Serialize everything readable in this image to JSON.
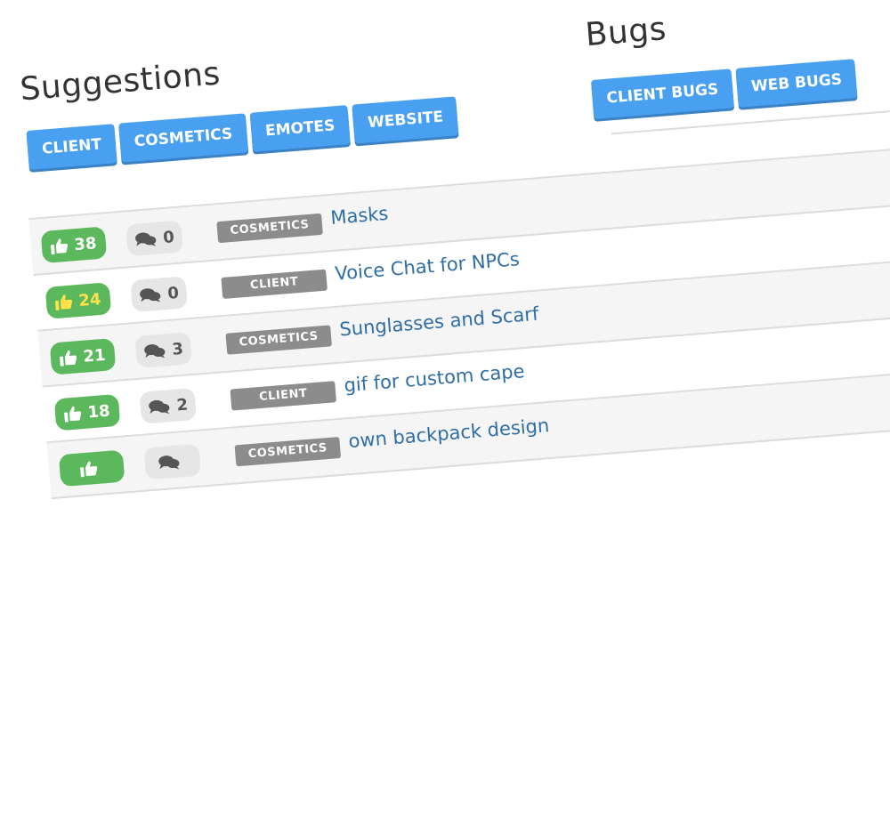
{
  "suggestions": {
    "heading": "Suggestions",
    "buttons": [
      "CLIENT",
      "COSMETICS",
      "EMOTES",
      "WEBSITE"
    ]
  },
  "bugs": {
    "heading": "Bugs",
    "buttons": [
      "CLIENT BUGS",
      "WEB BUGS"
    ]
  },
  "icons": {
    "vote": "thumbs-up-icon",
    "comments": "comments-icon"
  },
  "colors": {
    "primary_button": "#4aa0f0",
    "vote_badge": "#5cb85c",
    "hot_vote_text": "#ffe24a",
    "comment_badge": "#e6e6e6",
    "tag": "#8c8c8c",
    "link": "#2f6ea5"
  },
  "rows": [
    {
      "votes": "38",
      "comments": "0",
      "tag": "COSMETICS",
      "title": "Masks"
    },
    {
      "votes": "24",
      "comments": "0",
      "tag": "CLIENT",
      "title": "Voice Chat for NPCs"
    },
    {
      "votes": "21",
      "comments": "3",
      "tag": "COSMETICS",
      "title": "Sunglasses and Scarf"
    },
    {
      "votes": "18",
      "comments": "2",
      "tag": "CLIENT",
      "title": "gif for custom cape"
    },
    {
      "votes": "",
      "comments": "",
      "tag": "COSMETICS",
      "title": "own backpack design"
    }
  ]
}
